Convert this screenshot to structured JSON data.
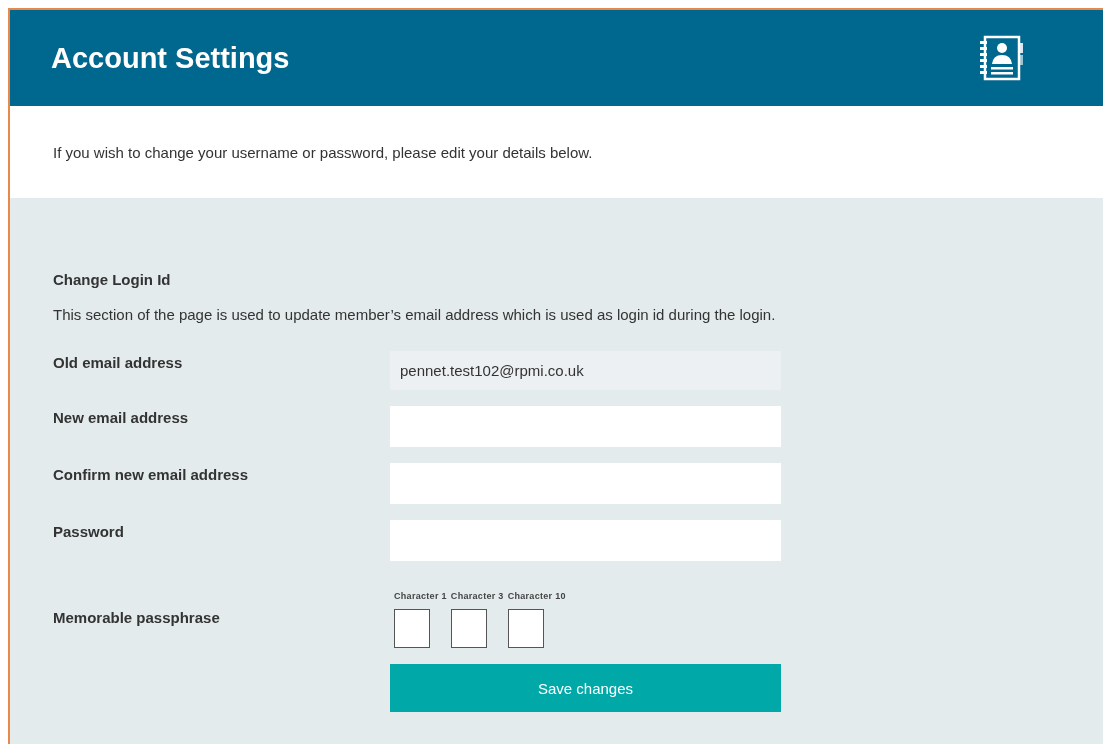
{
  "header": {
    "title": "Account Settings"
  },
  "intro": "If you wish to change your username or password, please edit your details below.",
  "section": {
    "heading": "Change Login Id",
    "description": "This section of the page is used to update member’s email address which is used as login id during the login."
  },
  "fields": [
    {
      "kind": "readonly",
      "label": "Old email address",
      "value": "pennet.test102@rpmi.co.uk"
    },
    {
      "kind": "text",
      "label": "New email address"
    },
    {
      "kind": "text",
      "label": "Confirm new email address"
    },
    {
      "kind": "password",
      "label": "Password"
    }
  ],
  "passphrase": {
    "label": "Memorable passphrase",
    "characters": [
      {
        "label": "Character 1"
      },
      {
        "label": "Character 3"
      },
      {
        "label": "Character 10"
      }
    ]
  },
  "save_button": "Save changes"
}
